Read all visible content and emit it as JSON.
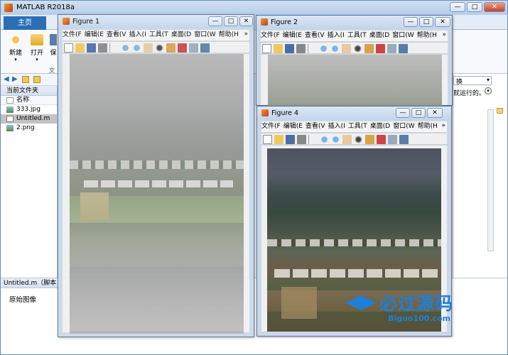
{
  "app": {
    "title": "MATLAB R2018a",
    "title_controls": [
      "—",
      "□",
      "✕"
    ]
  },
  "tabs": {
    "home": "主页"
  },
  "ribbon": {
    "new_label": "新建",
    "open_label": "打开",
    "save_label_partial": "保",
    "section_label_partial": "文"
  },
  "current_folder": {
    "title": "当前文件夹",
    "column_name": "名称",
    "files": [
      {
        "name": "333.jpg",
        "selected": false,
        "icon": "image-file-icon"
      },
      {
        "name": "Untitled.m",
        "selected": true,
        "icon": "m-file-icon"
      },
      {
        "name": "2.png",
        "selected": false,
        "icon": "image-file-icon"
      }
    ]
  },
  "details": {
    "file_label": "Untitled.m（脚本",
    "text": "原始图像"
  },
  "right_panel": {
    "dropdown_text": "换",
    "hint_text": "就运行的。"
  },
  "figure_menu": [
    "文件(F",
    "编辑(E",
    "查看(V",
    "插入(I",
    "工具(T",
    "桌面(D",
    "窗口(W",
    "帮助(H"
  ],
  "figures": {
    "fig1": {
      "title": "Figure 1"
    },
    "fig2": {
      "title": "Figure 2"
    },
    "fig4": {
      "title": "Figure 4"
    }
  },
  "watermark": {
    "title": "必过源码",
    "url": "Biguo100.com"
  },
  "colors": {
    "accent": "#2a6fb6",
    "watermark": "#1f7fd6"
  }
}
